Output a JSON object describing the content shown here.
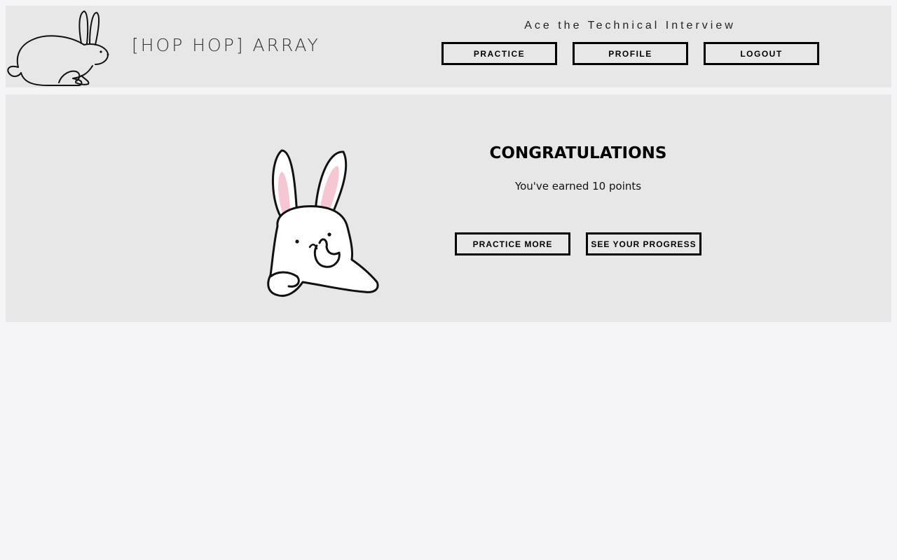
{
  "header": {
    "brand": "[HOP HOP] ARRAY",
    "tagline": "Ace the Technical Interview",
    "nav": {
      "practice": "PRACTICE",
      "profile": "PROFILE",
      "logout": "LOGOUT"
    }
  },
  "main": {
    "title": "CONGRATULATIONS",
    "message": "You've earned 10 points",
    "buttons": {
      "practice_more": "PRACTICE MORE",
      "see_progress": "SEE YOUR PROGRESS"
    }
  },
  "colors": {
    "page_background": "#f5f5f7",
    "panel_background": "#e7e7e7",
    "border": "#000000",
    "ear_pink": "#f7c6d3"
  },
  "icons": {
    "logo": "bunny-outline-icon",
    "illustration": "thinking-bunny-icon"
  }
}
